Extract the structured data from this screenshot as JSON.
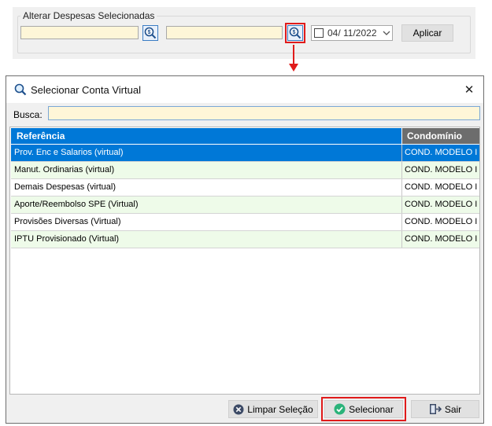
{
  "top_panel": {
    "group_title": "Alterar Despesas Selecionadas",
    "field1_value": "",
    "field2_value": "",
    "date_value": "04/ 11/2022",
    "apply_label": "Aplicar"
  },
  "dialog": {
    "title": "Selecionar Conta Virtual",
    "close_glyph": "✕",
    "search_label": "Busca:",
    "search_value": "",
    "columns": [
      "Referência",
      "Condomínio"
    ],
    "rows": [
      {
        "ref": "Prov. Enc e Salarios (virtual)",
        "cond": "COND. MODELO I",
        "selected": true
      },
      {
        "ref": "Manut. Ordinarias (virtual)",
        "cond": "COND. MODELO I"
      },
      {
        "ref": "Demais Despesas (virtual)",
        "cond": "COND. MODELO I"
      },
      {
        "ref": "Aporte/Reembolso SPE (Virtual)",
        "cond": "COND. MODELO I"
      },
      {
        "ref": "Provisões Diversas (Virtual)",
        "cond": "COND. MODELO I"
      },
      {
        "ref": "IPTU Provisionado (Virtual)",
        "cond": "COND. MODELO I"
      }
    ],
    "buttons": {
      "clear": "Limpar Seleção",
      "select": "Selecionar",
      "exit": "Sair"
    }
  },
  "colors": {
    "accent": "#0078d7",
    "field_bg": "#fef6d8",
    "alt_row": "#eefbe9",
    "highlight": "#e01b1b",
    "select_icon": "#2bb37a"
  },
  "icons": [
    "search-dollar-icon",
    "magnifier-icon",
    "close-icon",
    "dropdown-chevron-icon",
    "clear-x-icon",
    "check-circle-icon",
    "exit-door-icon",
    "red-arrow-down-icon"
  ]
}
